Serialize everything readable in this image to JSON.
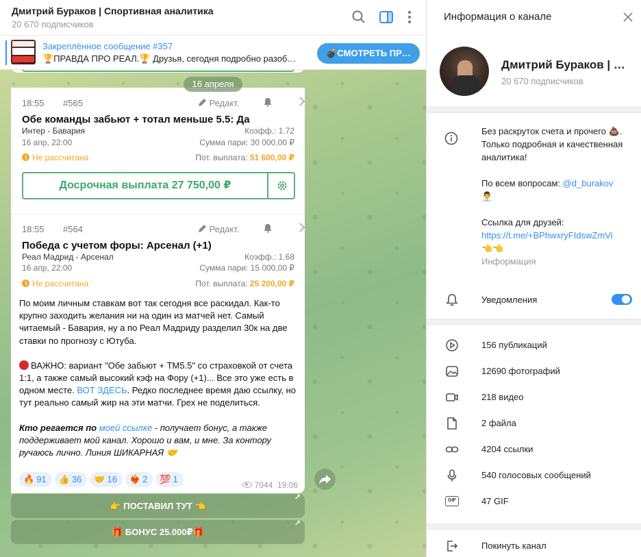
{
  "header": {
    "title": "Дмитрий Бураков | Спортивная аналитика",
    "subscribers": "20 670 подписчиков"
  },
  "pinned": {
    "title": "Закреплённое сообщение #357",
    "text": "🏆ПРАВДА ПРО РЕАЛ.🏆 Друзья, сегодня подробно разоб…",
    "button": "💣СМОТРЕТЬ ПР…"
  },
  "date_pill": "16 апреля",
  "cards": [
    {
      "time": "18:55",
      "number": "#565",
      "edit": "Редакт.",
      "title": "Обе команды забьют + тотал меньше 5.5: Да",
      "teams": "Интер - Бавария",
      "coef": "Коэфф.: 1.72",
      "date": "16 апр, 22:00",
      "stake": "Сумма пари: 30 000,00 ₽",
      "status": "Не рассчитана",
      "payout_label": "Пот. выплата:",
      "payout_value": "51 600,00 ₽",
      "cashout": "Досрочная выплата 27 750,00 ₽"
    },
    {
      "time": "18:55",
      "number": "#564",
      "edit": "Редакт.",
      "title": "Победа с учетом форы: Арсенал (+1)",
      "teams": "Реал Мадрид - Арсенал",
      "coef": "Коэфф.: 1.68",
      "date": "16 апр, 22:00",
      "stake": "Сумма пари: 15 000,00 ₽",
      "status": "Не рассчитана",
      "payout_label": "Пот. выплата:",
      "payout_value": "25 200,00 ₽"
    }
  ],
  "message": {
    "p1": "По моим личным ставкам вот так сегодня все раскидал. Как-то крупно заходить желания ни на один из матчей нет. Самый читаемый - Бавария, ну а по Реал Мадриду разделил 30к на две ставки по прогнозу с Ютуба.",
    "p2_a": "ВАЖНО: вариант \"Обе забьют + ТМ5.5\" со страховкой от счета 1:1, а также самый высокий кэф на Фору (+1)... Все это уже есть в одном месте. ",
    "p2_link": "ВОТ ЗДЕСЬ",
    "p2_b": ". Редко последнее время даю ссылку, но тут реально самый жир на эти матчи. Грех не поделиться.",
    "p3_a": "Кто регается по ",
    "p3_link": "моей ссылке",
    "p3_b": " - получает бонус, а также поддерживает мой канал. Хорошо и вам, и мне. За контору ручаюсь лично. Линия ШИКАРНАЯ 🤝"
  },
  "reactions": [
    {
      "emoji": "🔥",
      "count": "91"
    },
    {
      "emoji": "👍",
      "count": "36"
    },
    {
      "emoji": "🤝",
      "count": "16"
    },
    {
      "emoji": "❤️‍🔥",
      "count": "2"
    },
    {
      "emoji": "💯",
      "count": "1"
    }
  ],
  "views": "7044",
  "msg_time": "19:06",
  "inline_buttons": [
    "👉 ПОСТАВИЛ ТУТ 👈",
    "🎁 БОНУС 25.000₽🎁"
  ],
  "info": {
    "title": "Информация о канале",
    "channel_name": "Дмитрий Бураков | Спортивная аналитика",
    "subscribers": "20 670 подписчиков",
    "about_1": "Без раскруток счета и прочего 💩. Только подробная и качественная аналитика!",
    "about_2": "По всем вопросам: ",
    "about_2_link": "@d_burakov",
    "about_2_emoji": "👨‍💼",
    "about_3": "Ссылка для друзей:",
    "about_3_link": "https://t.me/+BPhwxryFIdswZmVi",
    "about_3_emoji": "👈👈",
    "about_label": "Информация",
    "notifications": "Уведомления",
    "notifications_on": true,
    "media": [
      "156 публикаций",
      "12690 фотографий",
      "218 видео",
      "2 файла",
      "4204 ссылки",
      "540 голосовых сообщений",
      "47 GIF"
    ],
    "leave": "Покинуть канал"
  },
  "colors": {
    "accent": "#3390ec",
    "green": "#3ea86b",
    "orange": "#f5a623"
  }
}
